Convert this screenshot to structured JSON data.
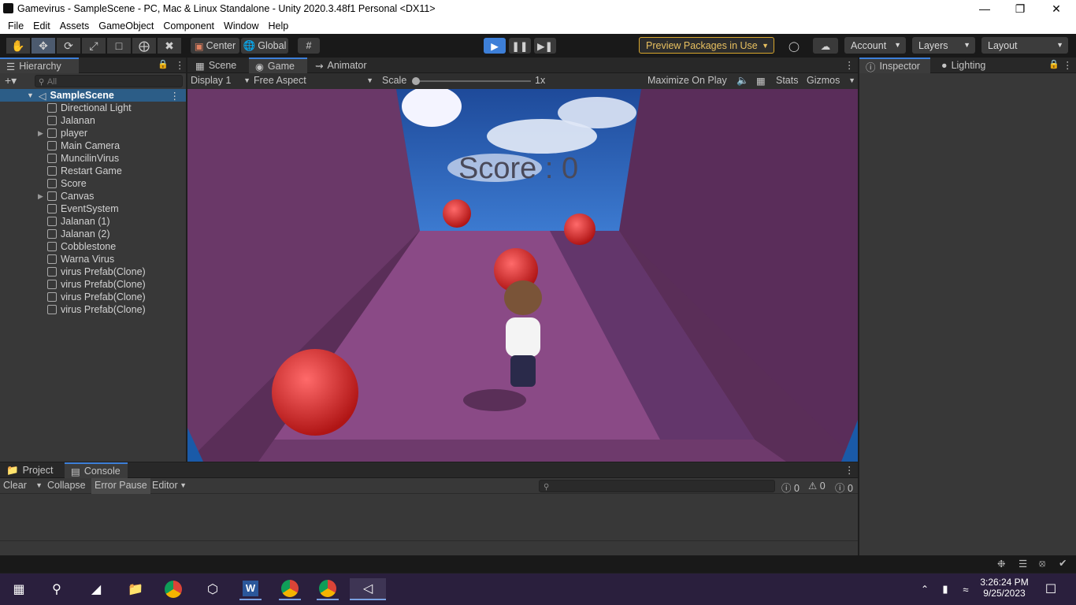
{
  "window": {
    "title": "Gamevirus - SampleScene - PC, Mac & Linux Standalone - Unity 2020.3.48f1 Personal <DX11>"
  },
  "menu": [
    "File",
    "Edit",
    "Assets",
    "GameObject",
    "Component",
    "Window",
    "Help"
  ],
  "toolbar": {
    "pivot": "Center",
    "space": "Global",
    "preview_packages": "Preview Packages in Use",
    "account": "Account",
    "layers": "Layers",
    "layout": "Layout"
  },
  "hierarchy": {
    "tab": "Hierarchy",
    "search_placeholder": "All",
    "scene": "SampleScene",
    "items": [
      {
        "label": "Directional Light",
        "expandable": false
      },
      {
        "label": "Jalanan",
        "expandable": false
      },
      {
        "label": "player",
        "expandable": true
      },
      {
        "label": "Main Camera",
        "expandable": false
      },
      {
        "label": "MuncilinVirus",
        "expandable": false
      },
      {
        "label": "Restart Game",
        "expandable": false
      },
      {
        "label": "Score",
        "expandable": false
      },
      {
        "label": "Canvas",
        "expandable": true
      },
      {
        "label": "EventSystem",
        "expandable": false
      },
      {
        "label": "Jalanan (1)",
        "expandable": false
      },
      {
        "label": "Jalanan (2)",
        "expandable": false
      },
      {
        "label": "Cobblestone",
        "expandable": false
      },
      {
        "label": "Warna Virus",
        "expandable": false
      },
      {
        "label": "virus Prefab(Clone)",
        "expandable": false
      },
      {
        "label": "virus Prefab(Clone)",
        "expandable": false
      },
      {
        "label": "virus Prefab(Clone)",
        "expandable": false
      },
      {
        "label": "virus Prefab(Clone)",
        "expandable": false
      }
    ]
  },
  "view_tabs": {
    "scene": "Scene",
    "game": "Game",
    "animator": "Animator"
  },
  "game_bar": {
    "display": "Display 1",
    "aspect": "Free Aspect",
    "scale_label": "Scale",
    "scale_value": "1x",
    "maximize": "Maximize On Play",
    "stats": "Stats",
    "gizmos": "Gizmos"
  },
  "game": {
    "score_text": "Score : 0"
  },
  "inspector": {
    "tab": "Inspector",
    "lighting": "Lighting"
  },
  "console": {
    "project_tab": "Project",
    "console_tab": "Console",
    "clear": "Clear",
    "collapse": "Collapse",
    "error_pause": "Error Pause",
    "editor": "Editor",
    "log_count": "0",
    "warn_count": "0",
    "error_count": "0"
  },
  "clock": {
    "time": "3:26:24 PM",
    "date": "9/25/2023"
  },
  "colors": {
    "accent": "#3d7fd8",
    "play_active": "#4c5a6e",
    "preview_border": "#d8a62c"
  }
}
